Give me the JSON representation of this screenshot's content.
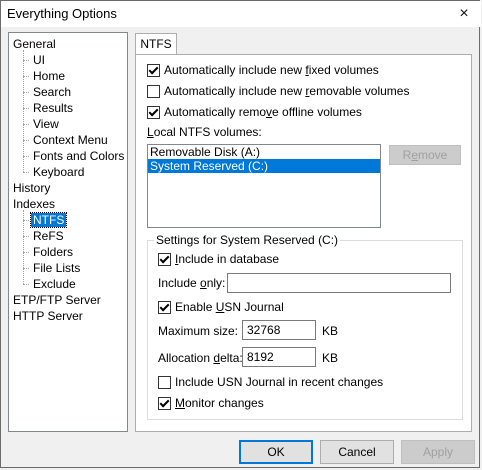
{
  "window": {
    "title": "Everything Options",
    "close_icon": "×"
  },
  "tree": {
    "items": [
      {
        "label": "General",
        "level": 0
      },
      {
        "label": "UI",
        "level": 1
      },
      {
        "label": "Home",
        "level": 1
      },
      {
        "label": "Search",
        "level": 1
      },
      {
        "label": "Results",
        "level": 1
      },
      {
        "label": "View",
        "level": 1
      },
      {
        "label": "Context Menu",
        "level": 1
      },
      {
        "label": "Fonts and Colors",
        "level": 1
      },
      {
        "label": "Keyboard",
        "level": 1
      },
      {
        "label": "History",
        "level": 0
      },
      {
        "label": "Indexes",
        "level": 0
      },
      {
        "label": "NTFS",
        "level": 1,
        "selected": true
      },
      {
        "label": "ReFS",
        "level": 1
      },
      {
        "label": "Folders",
        "level": 1
      },
      {
        "label": "File Lists",
        "level": 1
      },
      {
        "label": "Exclude",
        "level": 1
      },
      {
        "label": "ETP/FTP Server",
        "level": 0
      },
      {
        "label": "HTTP Server",
        "level": 0
      }
    ]
  },
  "tab": {
    "label": "NTFS"
  },
  "options": {
    "fixed": {
      "pre": "Automatically include new ",
      "u": "f",
      "post": "ixed volumes",
      "checked": true
    },
    "removable": {
      "pre": "Automatically include new ",
      "u": "r",
      "post": "emovable volumes",
      "checked": false
    },
    "offline": {
      "pre": "Automatically remo",
      "u": "v",
      "post": "e offline volumes",
      "checked": true
    }
  },
  "volumes": {
    "label_u": "L",
    "label_rest": "ocal NTFS volumes:",
    "items": [
      {
        "label": "Removable Disk (A:)",
        "selected": false
      },
      {
        "label": "System Reserved (C:)",
        "selected": true
      }
    ],
    "remove_pre": "R",
    "remove_u": "e",
    "remove_post": "move"
  },
  "settings": {
    "group_label": "Settings for System Reserved (C:)",
    "include_db": {
      "u": "I",
      "post": "nclude in database",
      "checked": true
    },
    "include_only": {
      "pre": "Include ",
      "u": "o",
      "post": "nly:",
      "value": ""
    },
    "usn": {
      "pre": "Enable ",
      "u": "U",
      "post": "SN Journal",
      "checked": true
    },
    "max_size": {
      "label": "Maximum size:",
      "value": "32768",
      "unit": "KB"
    },
    "alloc": {
      "pre": "Allocation ",
      "u": "d",
      "post": "elta:",
      "value": "8192",
      "unit": "KB"
    },
    "usn_recent": {
      "label": "Include USN Journal in recent changes",
      "checked": false
    },
    "monitor": {
      "u": "M",
      "post": "onitor changes",
      "checked": true
    }
  },
  "buttons": {
    "ok": "OK",
    "cancel": "Cancel",
    "apply": "Apply"
  }
}
